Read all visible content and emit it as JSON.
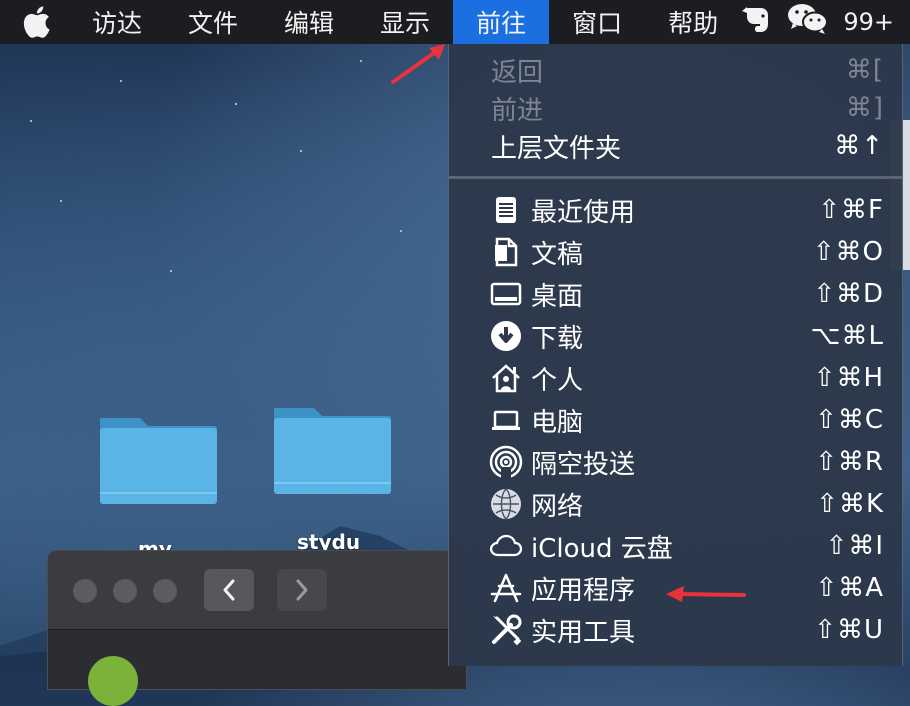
{
  "menubar": {
    "apple_icon": "apple-icon",
    "items": [
      {
        "label": "访达"
      },
      {
        "label": "文件"
      },
      {
        "label": "编辑"
      },
      {
        "label": "显示"
      },
      {
        "label": "前往",
        "active": true
      },
      {
        "label": "窗口"
      },
      {
        "label": "帮助"
      }
    ],
    "status": {
      "evernote_icon": "elephant-icon",
      "wechat_icon": "wechat-icon",
      "badge": "99+"
    }
  },
  "desktop": {
    "folders": [
      {
        "label": "my"
      },
      {
        "label": "stydu"
      }
    ]
  },
  "menu": {
    "nav_items": [
      {
        "label": "返回",
        "shortcut": "⌘[",
        "disabled": true
      },
      {
        "label": "前进",
        "shortcut": "⌘]",
        "disabled": true
      },
      {
        "label": "上层文件夹",
        "shortcut": "⌘↑",
        "disabled": false
      }
    ],
    "places": [
      {
        "label": "最近使用",
        "shortcut": "⇧⌘F",
        "icon": "recents-icon"
      },
      {
        "label": "文稿",
        "shortcut": "⇧⌘O",
        "icon": "document-icon"
      },
      {
        "label": "桌面",
        "shortcut": "⇧⌘D",
        "icon": "desktop-icon"
      },
      {
        "label": "下载",
        "shortcut": "⌥⌘L",
        "icon": "download-icon"
      },
      {
        "label": "个人",
        "shortcut": "⇧⌘H",
        "icon": "home-icon"
      },
      {
        "label": "电脑",
        "shortcut": "⇧⌘C",
        "icon": "computer-icon"
      },
      {
        "label": "隔空投送",
        "shortcut": "⇧⌘R",
        "icon": "airdrop-icon"
      },
      {
        "label": "网络",
        "shortcut": "⇧⌘K",
        "icon": "network-icon"
      },
      {
        "label": "iCloud 云盘",
        "shortcut": "⇧⌘I",
        "icon": "icloud-icon"
      },
      {
        "label": "应用程序",
        "shortcut": "⇧⌘A",
        "icon": "applications-icon"
      },
      {
        "label": "实用工具",
        "shortcut": "⇧⌘U",
        "icon": "utilities-icon"
      }
    ]
  },
  "colors": {
    "menubar_bg": "#1b1d21",
    "active_menu": "#1b6fe0",
    "menu_bg": "#2c384a",
    "annotation_arrow": "#e8333b"
  }
}
